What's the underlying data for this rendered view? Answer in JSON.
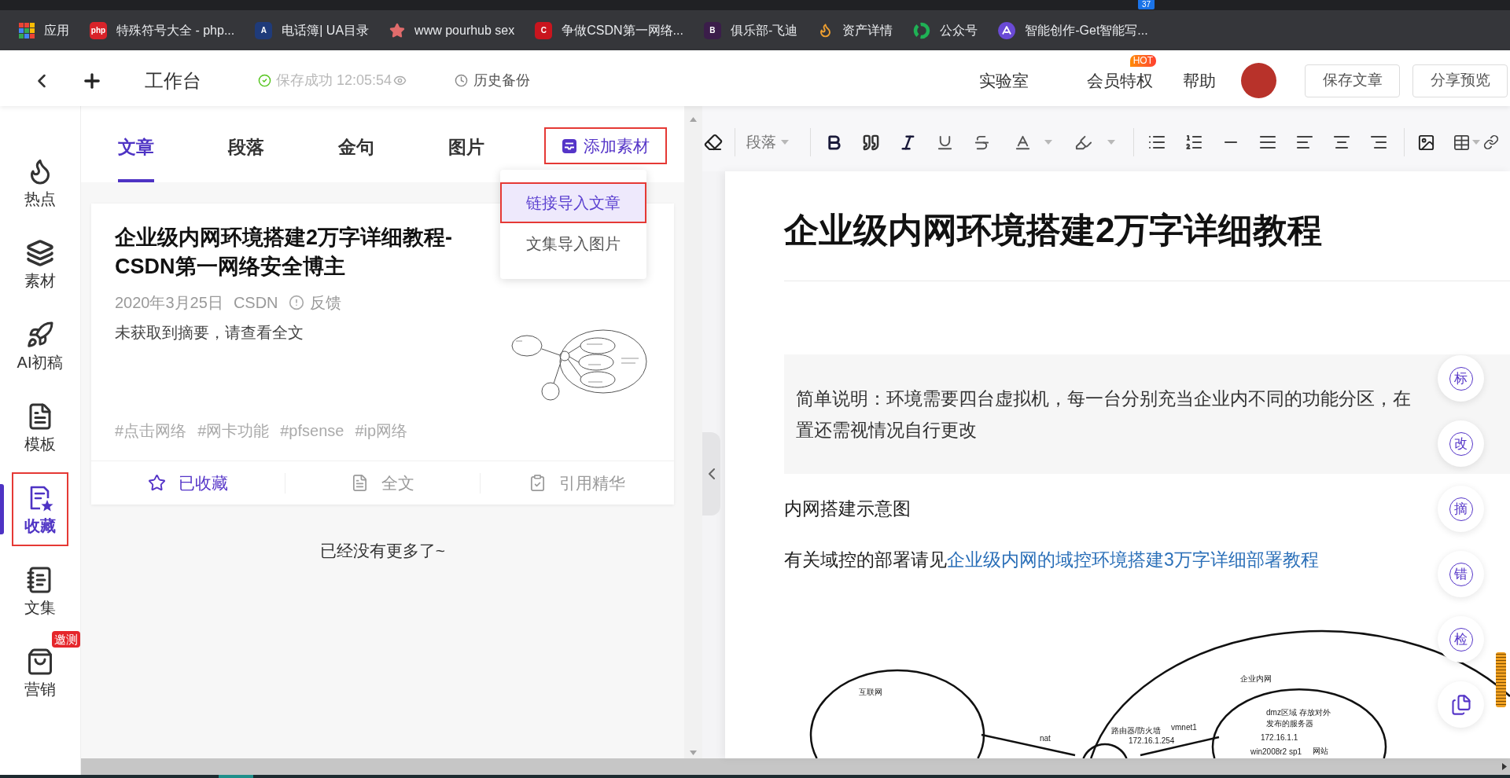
{
  "browser": {
    "tab_badge": "37",
    "bookmarks": [
      {
        "label": "应用"
      },
      {
        "label": "特殊符号大全 - php...",
        "logo_text": "php",
        "color": "#d8232a"
      },
      {
        "label": "电话簿| UA目录",
        "logo_text": "A",
        "color": "#1f3b7a"
      },
      {
        "label": "www pourhub sex"
      },
      {
        "label": "争做CSDN第一网络...",
        "logo_text": "C",
        "color": "#c9151e"
      },
      {
        "label": "俱乐部-飞迪",
        "logo_text": "B",
        "color": "#3b1d4a"
      },
      {
        "label": "资产详情"
      },
      {
        "label": "公众号"
      },
      {
        "label": "智能创作-Get智能写..."
      }
    ]
  },
  "header": {
    "title": "工作台",
    "save_status": "保存成功 12:05:54",
    "history": "历史备份",
    "nav": [
      {
        "label": "实验室"
      },
      {
        "label": "会员特权",
        "badge": "HOT"
      },
      {
        "label": "帮助"
      }
    ],
    "buttons": [
      "保存文章",
      "分享预览"
    ]
  },
  "sidebar": {
    "items": [
      {
        "label": "热点",
        "selected": false,
        "boxed": false
      },
      {
        "label": "素材",
        "selected": false,
        "boxed": false
      },
      {
        "label": "AI初稿",
        "selected": false,
        "boxed": false
      },
      {
        "label": "模板",
        "selected": false,
        "boxed": false
      },
      {
        "label": "收藏",
        "selected": true,
        "boxed": true
      },
      {
        "label": "文集",
        "selected": false,
        "boxed": false
      },
      {
        "label": "营销",
        "selected": false,
        "boxed": false,
        "badge": "邀测"
      }
    ]
  },
  "material_panel": {
    "tabs": [
      {
        "label": "文章",
        "selected": true
      },
      {
        "label": "段落",
        "selected": false
      },
      {
        "label": "金句",
        "selected": false
      },
      {
        "label": "图片",
        "selected": false
      }
    ],
    "add_button": {
      "label": "添加素材",
      "boxed": true
    },
    "add_menu": {
      "items": [
        {
          "label": "链接导入文章",
          "selected": true,
          "boxed": true
        },
        {
          "label": "文集导入图片",
          "selected": false,
          "boxed": false
        }
      ]
    },
    "cards": [
      {
        "title_lines": [
          "企业级内网环境搭建2万字详细教程-",
          "CSDN第一网络安全博主"
        ],
        "date": "2020年3月25日",
        "source": "CSDN",
        "feedback": "反馈",
        "summary": "未获取到摘要，请查看全文",
        "tags": [
          "#点击网络",
          "#网卡功能",
          "#pfsense",
          "#ip网络"
        ],
        "actions": [
          {
            "label": "已收藏",
            "selected": true
          },
          {
            "label": "全文",
            "selected": false
          },
          {
            "label": "引用精华",
            "selected": false
          }
        ]
      }
    ],
    "end_note": "已经没有更多了~"
  },
  "editor": {
    "toolbar": {
      "block_format": "段落"
    },
    "document": {
      "title": "企业级内网环境搭建2万字详细教程",
      "note_lines": [
        "简单说明：环境需要四台虚拟机，每一台分别充当企业内不同的功能分区，在",
        "置还需视情况自行更改"
      ],
      "caption": "内网搭建示意图",
      "reference": {
        "text": "有关域控的部署请见",
        "link": "企业级内网的域控环境搭建3万字详细部署教程"
      },
      "diagram": {
        "labels": [
          "互联网",
          "nat",
          "路由器/防火墙",
          "vmnet1",
          "172.16.1.254",
          "企业内网",
          "dmz区域",
          "存放对外",
          "发布的服务器",
          "172.16.1.1",
          "win2008r2 sp1",
          "网站"
        ]
      }
    },
    "side_tools": [
      {
        "kind": "glyph",
        "label": "标"
      },
      {
        "kind": "glyph",
        "label": "改"
      },
      {
        "kind": "glyph",
        "label": "摘"
      },
      {
        "kind": "glyph",
        "label": "错"
      },
      {
        "kind": "glyph",
        "label": "检"
      },
      {
        "kind": "document"
      }
    ]
  }
}
